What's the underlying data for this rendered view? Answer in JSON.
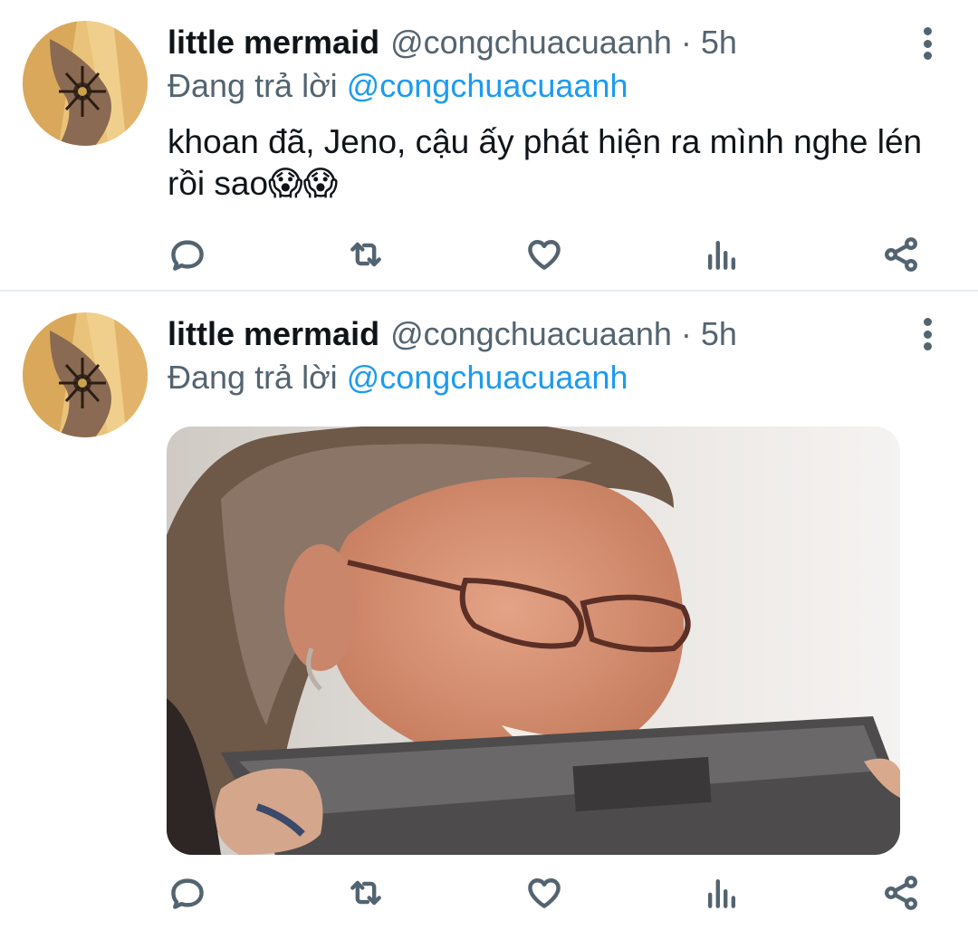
{
  "tweets": [
    {
      "display_name": "little mermaid",
      "handle": "@congchuacuaanh",
      "separator": "·",
      "time": "5h",
      "reply_prefix": "Đang trả lời",
      "reply_handle": "@congchuacuaanh",
      "text": "khoan đã, Jeno, cậu ấy phát hiện ra mình nghe lén rồi sao😱😱"
    },
    {
      "display_name": "little mermaid",
      "handle": "@congchuacuaanh",
      "separator": "·",
      "time": "5h",
      "reply_prefix": "Đang trả lời",
      "reply_handle": "@congchuacuaanh"
    }
  ],
  "icons": {
    "more": "more-vertical-icon",
    "reply": "reply-icon",
    "retweet": "retweet-icon",
    "like": "heart-icon",
    "analytics": "analytics-icon",
    "share": "share-icon"
  },
  "colors": {
    "primary_text": "#0f1419",
    "secondary_text": "#536471",
    "mention": "#1d9bf0",
    "divider": "#e6ecf0"
  }
}
